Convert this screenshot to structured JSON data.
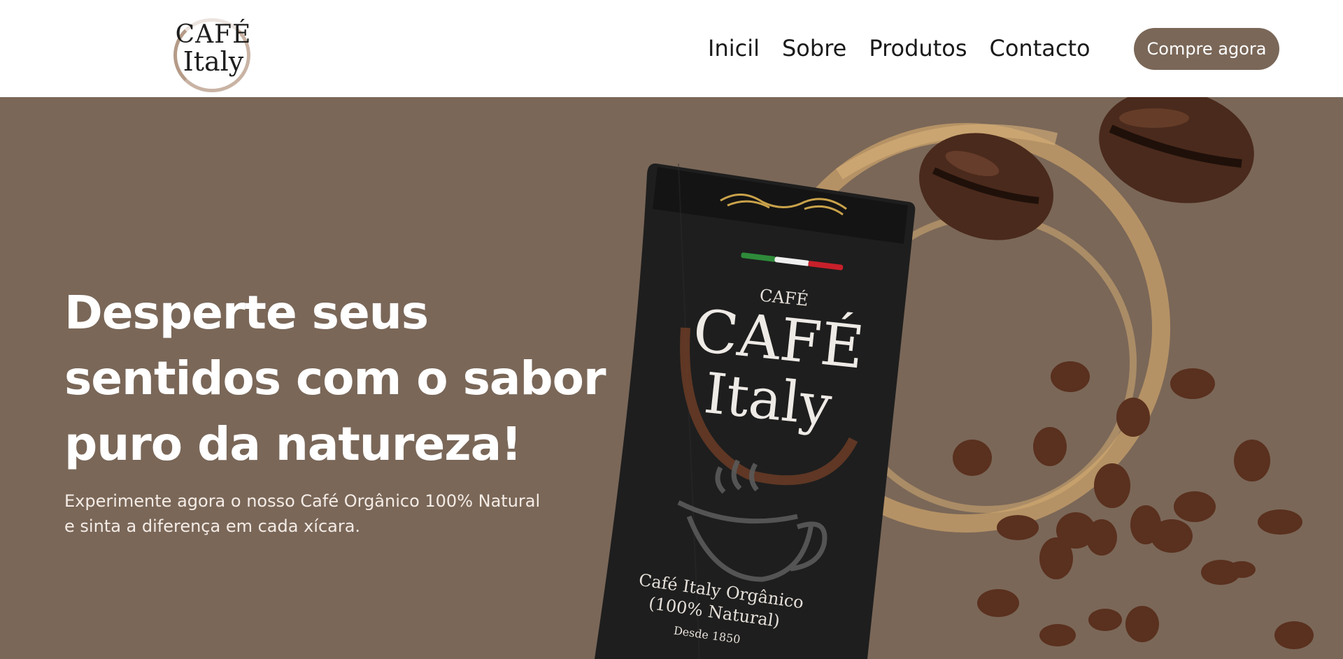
{
  "brand": {
    "logo_line1": "CAFÉ",
    "logo_line2": "Italy",
    "primary_color": "#7a6758",
    "header_bg": "#ffffff"
  },
  "nav": {
    "items": [
      {
        "label": "Inicil"
      },
      {
        "label": "Sobre"
      },
      {
        "label": "Produtos"
      },
      {
        "label": "Contacto"
      }
    ],
    "cta_label": "Compre agora"
  },
  "hero": {
    "headline_line1": "Desperte seus",
    "headline_line2": "sentidos com o sabor",
    "headline_line3": "puro da natureza!",
    "sub_line1": "Experimente agora o nosso Café Orgânico 100% Natural",
    "sub_line2": "e sinta a diferença em cada xícara."
  },
  "package": {
    "label_small": "CAFÉ",
    "label_big1": "CAFÉ",
    "label_big2": "Italy",
    "desc_line1": "Café Italy Orgânico",
    "desc_line2": "(100% Natural)",
    "desc_line3": "Desde 1850",
    "flag_colors": [
      "#2e8b3a",
      "#ffffff",
      "#c8202a"
    ]
  }
}
